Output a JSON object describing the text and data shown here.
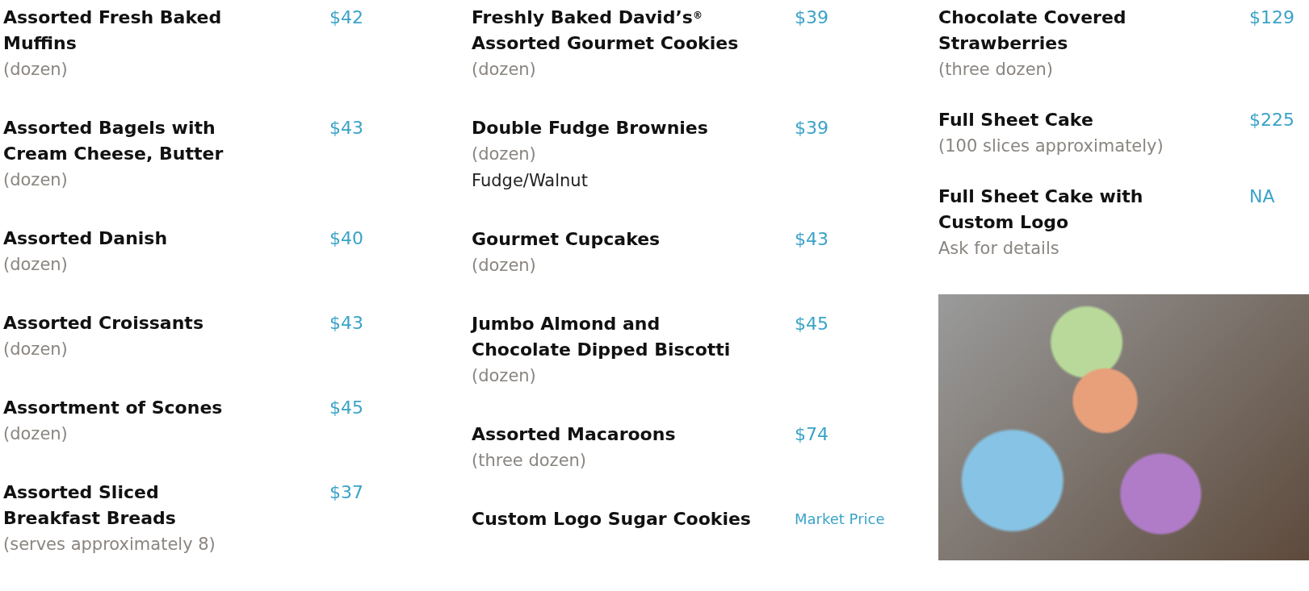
{
  "columns": [
    {
      "items": [
        {
          "name": "Assorted Fresh Baked Muffins",
          "price": "$42",
          "details": [
            {
              "kind": "size",
              "text": "(dozen)"
            }
          ]
        },
        {
          "name": "Assorted Bagels with Cream Cheese, Butter",
          "price": "$43",
          "details": [
            {
              "kind": "size",
              "text": "(dozen)"
            }
          ]
        },
        {
          "name": "Assorted Danish",
          "price": "$40",
          "details": [
            {
              "kind": "size",
              "text": "(dozen)"
            }
          ]
        },
        {
          "name": "Assorted Croissants",
          "price": "$43",
          "details": [
            {
              "kind": "size",
              "text": "(dozen)"
            }
          ]
        },
        {
          "name": "Assortment of Scones",
          "price": "$45",
          "details": [
            {
              "kind": "size",
              "text": "(dozen)"
            }
          ]
        },
        {
          "name": "Assorted Sliced Breakfast Breads",
          "price": "$37",
          "details": [
            {
              "kind": "size",
              "text": "(serves approximately 8)"
            }
          ]
        }
      ]
    },
    {
      "items": [
        {
          "name": "Freshly Baked David’s$^{®}$ Assorted Gourmet Cookies",
          "price": "$39",
          "details": [
            {
              "kind": "size",
              "text": "(dozen)"
            }
          ]
        },
        {
          "name": "Double Fudge Brownies",
          "price": "$39",
          "details": [
            {
              "kind": "size",
              "text": "(dozen)"
            },
            {
              "kind": "note",
              "text": "Fudge/Walnut"
            }
          ]
        },
        {
          "name": "Gourmet Cupcakes",
          "price": "$43",
          "details": [
            {
              "kind": "size",
              "text": "(dozen)"
            }
          ]
        },
        {
          "name": "Jumbo Almond and Chocolate Dipped Biscotti",
          "price": "$45",
          "details": [
            {
              "kind": "size",
              "text": "(dozen)"
            }
          ]
        },
        {
          "name": "Assorted Macaroons",
          "price": "$74",
          "details": [
            {
              "kind": "size",
              "text": "(three dozen)"
            }
          ]
        },
        {
          "name": "Custom Logo Sugar Cookies",
          "price": "Market Price"
        }
      ]
    },
    {
      "items": [
        {
          "name": "Chocolate Covered Strawberries",
          "price": "$129",
          "details": [
            {
              "kind": "size",
              "text": "(three dozen)"
            }
          ]
        },
        {
          "name": "Full Sheet Cake",
          "price": "$225",
          "details": [
            {
              "kind": "size",
              "text": "(100 slices approximately)"
            }
          ]
        },
        {
          "name": "Full Sheet Cake with Custom Logo",
          "price": "NA",
          "details": [
            {
              "kind": "size",
              "text": "Ask for details"
            }
          ]
        }
      ],
      "photo": true
    }
  ]
}
